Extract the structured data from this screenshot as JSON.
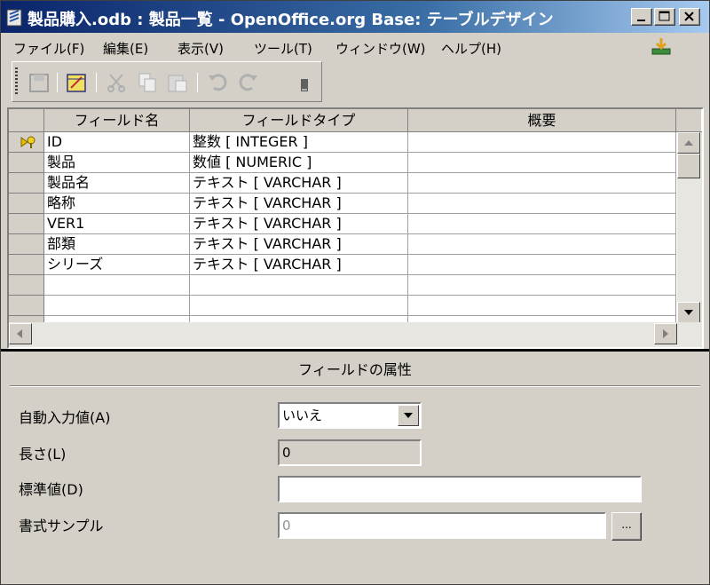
{
  "window": {
    "title": "製品購入.odb : 製品一覧 - OpenOffice.org Base: テーブルデザイン",
    "minimize_label": "_",
    "maximize_label": "□",
    "close_label": "×"
  },
  "menu": {
    "items": [
      {
        "label": "ファイル(F)"
      },
      {
        "label": "編集(E)"
      },
      {
        "label": "表示(V)"
      },
      {
        "label": "ツール(T)"
      },
      {
        "label": "ウィンドウ(W)"
      },
      {
        "label": "ヘルプ(H)"
      }
    ]
  },
  "toolbar": {
    "icons": [
      "save-icon",
      "table-edit-icon",
      "cut-icon",
      "copy-icon",
      "paste-icon",
      "undo-icon",
      "redo-icon",
      "toolbar-options-icon"
    ]
  },
  "grid": {
    "columns": [
      "フィールド名",
      "フィールドタイプ",
      "概要"
    ],
    "rows": [
      {
        "name": "ID",
        "type": "整数 [ INTEGER ]",
        "description": "",
        "primary_key": true
      },
      {
        "name": "製品",
        "type": "数値 [ NUMERIC ]",
        "description": ""
      },
      {
        "name": "製品名",
        "type": "テキスト [ VARCHAR ]",
        "description": ""
      },
      {
        "name": "略称",
        "type": "テキスト [ VARCHAR ]",
        "description": ""
      },
      {
        "name": "VER1",
        "type": "テキスト [ VARCHAR ]",
        "description": ""
      },
      {
        "name": "部類",
        "type": "テキスト [ VARCHAR ]",
        "description": ""
      },
      {
        "name": "シリーズ",
        "type": "テキスト [ VARCHAR ]",
        "description": ""
      },
      {
        "name": "",
        "type": "",
        "description": ""
      },
      {
        "name": "",
        "type": "",
        "description": ""
      },
      {
        "name": "",
        "type": "",
        "description": ""
      }
    ]
  },
  "properties": {
    "title": "フィールドの属性",
    "auto_value_label": "自動入力値(A)",
    "auto_value": "いいえ",
    "length_label": "長さ(L)",
    "length_value": "0",
    "default_label": "標準値(D)",
    "default_value": "",
    "format_label": "書式サンプル",
    "format_value": "0",
    "format_button_label": "..."
  }
}
